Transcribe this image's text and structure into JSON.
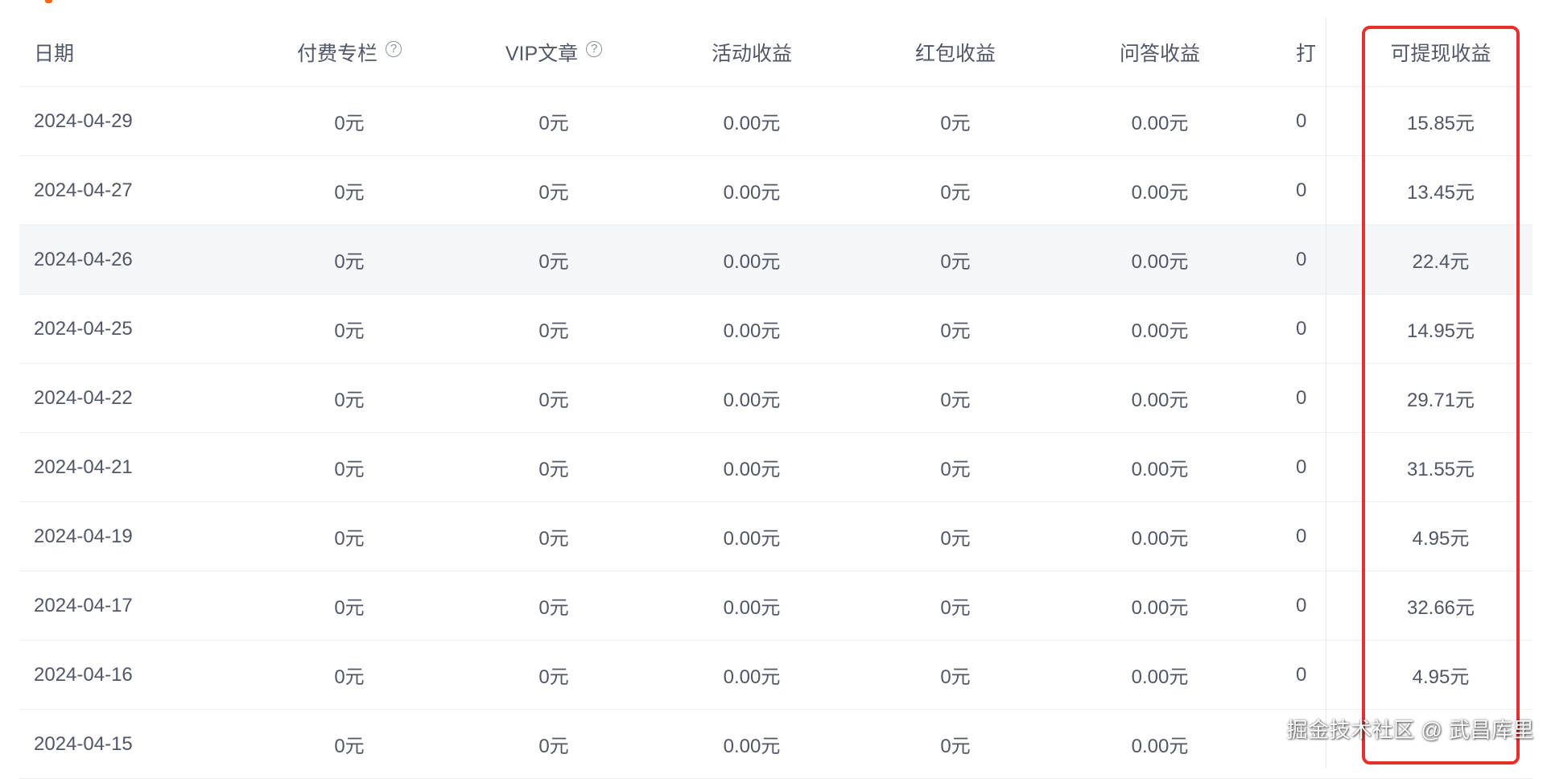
{
  "table": {
    "headers": {
      "date": "日期",
      "paid_column": "付费专栏",
      "vip_article": "VIP文章",
      "activity": "活动收益",
      "red_packet": "红包收益",
      "qa": "问答收益",
      "tip": "打",
      "withdrawable": "可提现收益"
    },
    "rows": [
      {
        "date": "2024-04-29",
        "paid_column": "0元",
        "vip_article": "0元",
        "activity": "0.00元",
        "red_packet": "0元",
        "qa": "0.00元",
        "tip": "0",
        "withdrawable": "15.85元"
      },
      {
        "date": "2024-04-27",
        "paid_column": "0元",
        "vip_article": "0元",
        "activity": "0.00元",
        "red_packet": "0元",
        "qa": "0.00元",
        "tip": "0",
        "withdrawable": "13.45元"
      },
      {
        "date": "2024-04-26",
        "paid_column": "0元",
        "vip_article": "0元",
        "activity": "0.00元",
        "red_packet": "0元",
        "qa": "0.00元",
        "tip": "0",
        "withdrawable": "22.4元"
      },
      {
        "date": "2024-04-25",
        "paid_column": "0元",
        "vip_article": "0元",
        "activity": "0.00元",
        "red_packet": "0元",
        "qa": "0.00元",
        "tip": "0",
        "withdrawable": "14.95元"
      },
      {
        "date": "2024-04-22",
        "paid_column": "0元",
        "vip_article": "0元",
        "activity": "0.00元",
        "red_packet": "0元",
        "qa": "0.00元",
        "tip": "0",
        "withdrawable": "29.71元"
      },
      {
        "date": "2024-04-21",
        "paid_column": "0元",
        "vip_article": "0元",
        "activity": "0.00元",
        "red_packet": "0元",
        "qa": "0.00元",
        "tip": "0",
        "withdrawable": "31.55元"
      },
      {
        "date": "2024-04-19",
        "paid_column": "0元",
        "vip_article": "0元",
        "activity": "0.00元",
        "red_packet": "0元",
        "qa": "0.00元",
        "tip": "0",
        "withdrawable": "4.95元"
      },
      {
        "date": "2024-04-17",
        "paid_column": "0元",
        "vip_article": "0元",
        "activity": "0.00元",
        "red_packet": "0元",
        "qa": "0.00元",
        "tip": "0",
        "withdrawable": "32.66元"
      },
      {
        "date": "2024-04-16",
        "paid_column": "0元",
        "vip_article": "0元",
        "activity": "0.00元",
        "red_packet": "0元",
        "qa": "0.00元",
        "tip": "0",
        "withdrawable": "4.95元"
      },
      {
        "date": "2024-04-15",
        "paid_column": "0元",
        "vip_article": "0元",
        "activity": "0.00元",
        "red_packet": "0元",
        "qa": "0.00元",
        "tip": "",
        "withdrawable": ""
      }
    ]
  },
  "icons": {
    "help": "question-circle-icon"
  },
  "colors": {
    "highlight": "#e8302b",
    "accent": "#f06a1a",
    "hover_row": "#f6f7f9"
  },
  "watermark": "掘金技术社区 @ 武昌库里"
}
